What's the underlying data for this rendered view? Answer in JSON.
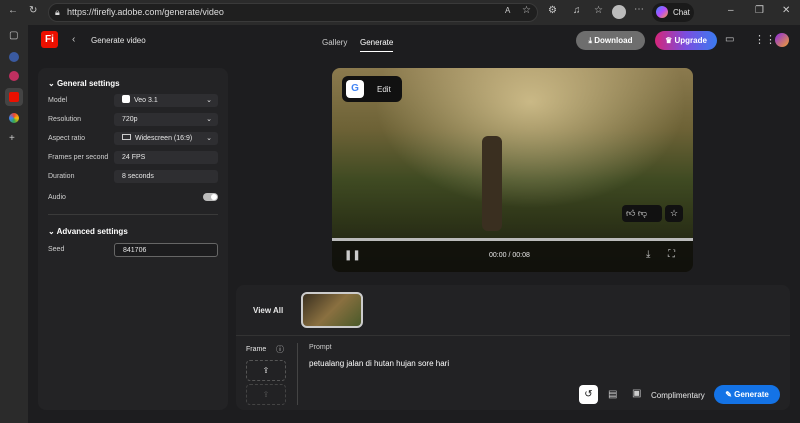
{
  "browser": {
    "url": "https://firefly.adobe.com/generate/video",
    "chat_label": "Chat"
  },
  "header": {
    "logo": "Fi",
    "title": "Generate video",
    "tabs": [
      {
        "label": "Gallery"
      },
      {
        "label": "Generate"
      }
    ],
    "download_label": "Download",
    "upgrade_label": "Upgrade"
  },
  "settings": {
    "general_title": "General settings",
    "model_label": "Model",
    "model_value": "Veo 3.1",
    "resolution_label": "Resolution",
    "resolution_value": "720p",
    "aspect_label": "Aspect ratio",
    "aspect_value": "Widescreen (16:9)",
    "fps_label": "Frames per second",
    "fps_value": "24 FPS",
    "duration_label": "Duration",
    "duration_value": "8 seconds",
    "audio_label": "Audio",
    "audio_on": true,
    "advanced_title": "Advanced settings",
    "seed_label": "Seed",
    "seed_value": "841706"
  },
  "video": {
    "edit_label": "Edit",
    "time": "00:00 / 00:08",
    "progress": 0
  },
  "bottom": {
    "view_all": "View All",
    "frame_label": "Frame",
    "prompt_label": "Prompt",
    "prompt_value": "petualang jalan di hutan hujan sore hari",
    "complimentary": "Complimentary",
    "generate_label": "Generate"
  },
  "colors": {
    "accent": "#1473e6",
    "brand": "#eb1000"
  }
}
